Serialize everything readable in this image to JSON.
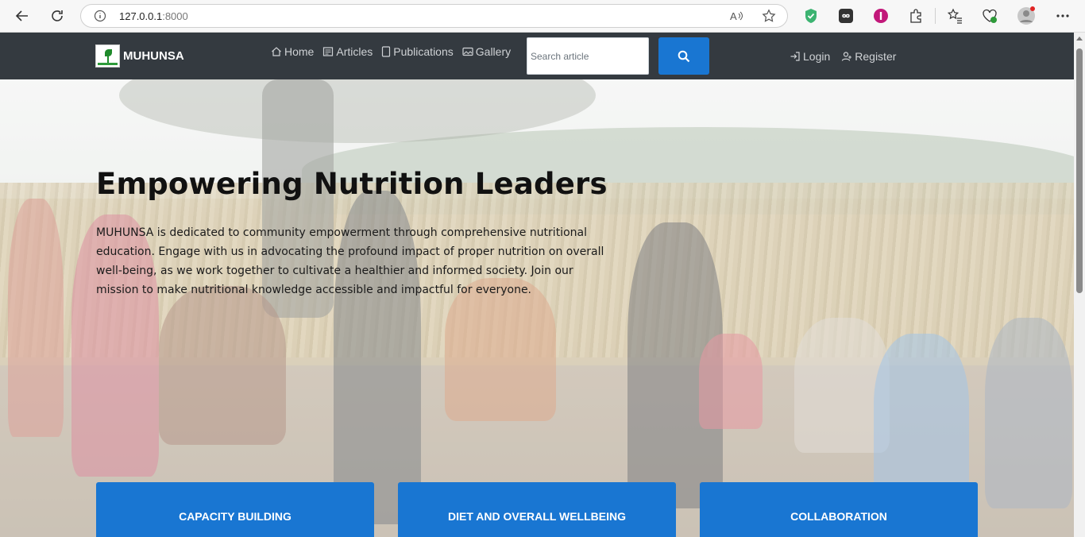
{
  "browser": {
    "url_host": "127.0.0.1",
    "url_port": ":8000"
  },
  "navbar": {
    "brand": "MUHUNSA",
    "links": [
      {
        "label": "Home",
        "icon": "home-icon"
      },
      {
        "label": "Articles",
        "icon": "newspaper-icon"
      },
      {
        "label": "Publications",
        "icon": "document-icon"
      },
      {
        "label": "Gallery",
        "icon": "image-icon"
      }
    ],
    "search_placeholder": "Search article",
    "auth": [
      {
        "label": "Login",
        "icon": "login-icon"
      },
      {
        "label": "Register",
        "icon": "user-add-icon"
      }
    ]
  },
  "hero": {
    "title": "Empowering Nutrition Leaders",
    "description": "MUHUNSA is dedicated to community empowerment through comprehensive nutritional education. Engage with us in advocating the profound impact of proper nutrition on overall well-being, as we work together to cultivate a healthier and informed society. Join our mission to make nutritional knowledge accessible and impactful for everyone."
  },
  "cards": [
    {
      "label": "CAPACITY BUILDING"
    },
    {
      "label": "DIET AND OVERALL WELLBEING"
    },
    {
      "label": "COLLABORATION"
    }
  ],
  "colors": {
    "navbar": "#343a40",
    "accent": "#1976d2"
  }
}
